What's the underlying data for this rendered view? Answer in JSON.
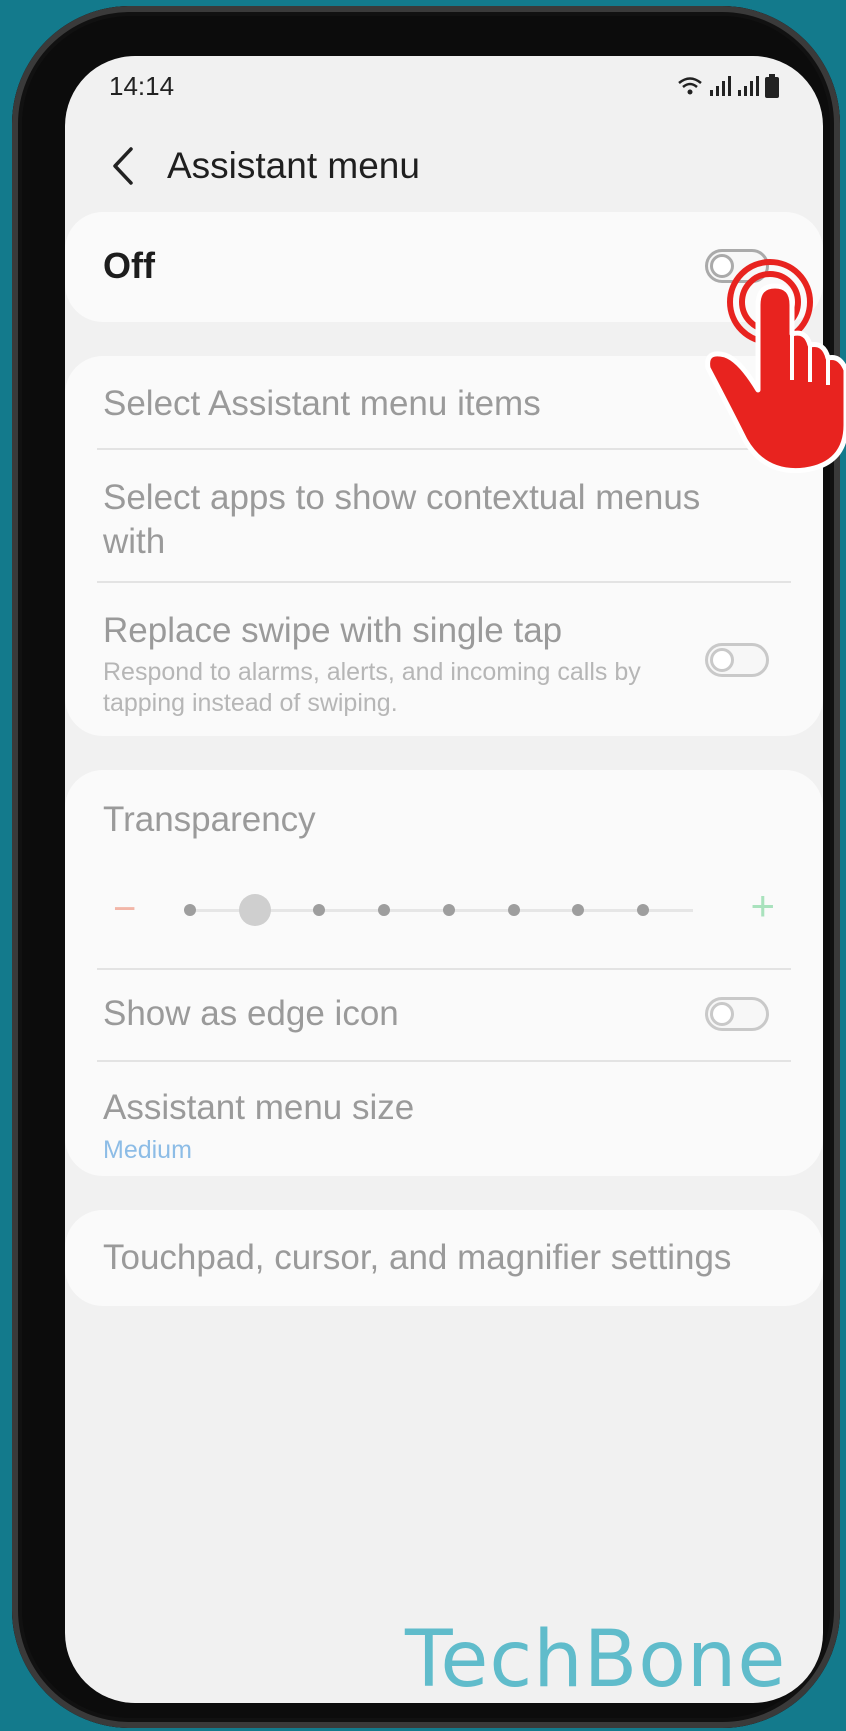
{
  "status_bar": {
    "time": "14:14",
    "icons": [
      "wifi-icon",
      "signal-icon",
      "signal-icon",
      "battery-icon"
    ]
  },
  "header": {
    "title": "Assistant menu"
  },
  "master": {
    "label": "Off",
    "on": false
  },
  "items": {
    "select_items": "Select Assistant menu items",
    "select_apps": "Select apps to show contextual menus with",
    "replace_swipe": {
      "title": "Replace swipe with single tap",
      "subtitle": "Respond to alarms, alerts, and incoming calls by tapping instead of swiping.",
      "on": false
    }
  },
  "transparency": {
    "label": "Transparency",
    "levels": 8,
    "selected_level": 2
  },
  "edge_icon": {
    "label": "Show as edge icon",
    "on": false
  },
  "menu_size": {
    "label": "Assistant menu size",
    "value": "Medium"
  },
  "touchpad": {
    "label": "Touchpad, cursor, and magnifier settings"
  },
  "watermark": "TechBone",
  "colors": {
    "background": "#137a8c",
    "accent": "#4a90d9",
    "watermark": "#60bccb",
    "hand": "#e8231f"
  }
}
